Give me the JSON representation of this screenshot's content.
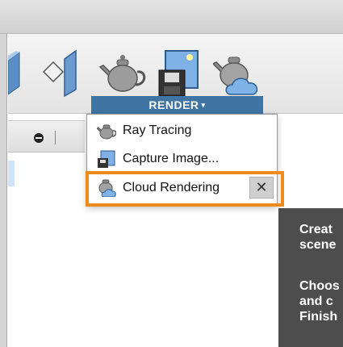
{
  "render_panel": {
    "label": "RENDER",
    "caret": "▾"
  },
  "menu": {
    "items": [
      {
        "label": "Ray Tracing",
        "icon": "teapot-icon"
      },
      {
        "label": "Capture Image...",
        "icon": "capture-image-icon"
      },
      {
        "label": "Cloud Rendering",
        "icon": "cloud-teapot-icon"
      }
    ],
    "close_symbol": "✕"
  },
  "tooltip": {
    "line1": "Creat",
    "line2": "scene",
    "line3": "Choos",
    "line4": "and c",
    "line5": "Finish"
  },
  "colors": {
    "render_blue": "#3f74a3",
    "highlight_orange": "#f08a1c",
    "tooltip_bg": "#4d4d4d"
  }
}
